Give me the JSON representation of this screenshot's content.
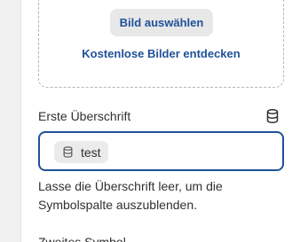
{
  "image_picker": {
    "select_button_label": "Bild auswählen",
    "free_images_link": "Kostenlose Bilder entdecken"
  },
  "heading_field": {
    "label": "Erste Überschrift",
    "source_icon": "database-icon",
    "chip_icon": "database-icon",
    "value": "test",
    "help_text": "Lasse die Überschrift leer, um die Symbolspalte auszublenden.",
    "focus_color": "#1f5199"
  },
  "next_field": {
    "label": "Zweites Symbol"
  },
  "colors": {
    "accent": "#1f5199",
    "button_bg": "#e8e8e8",
    "chip_bg": "#ebebeb",
    "text": "#303030"
  }
}
